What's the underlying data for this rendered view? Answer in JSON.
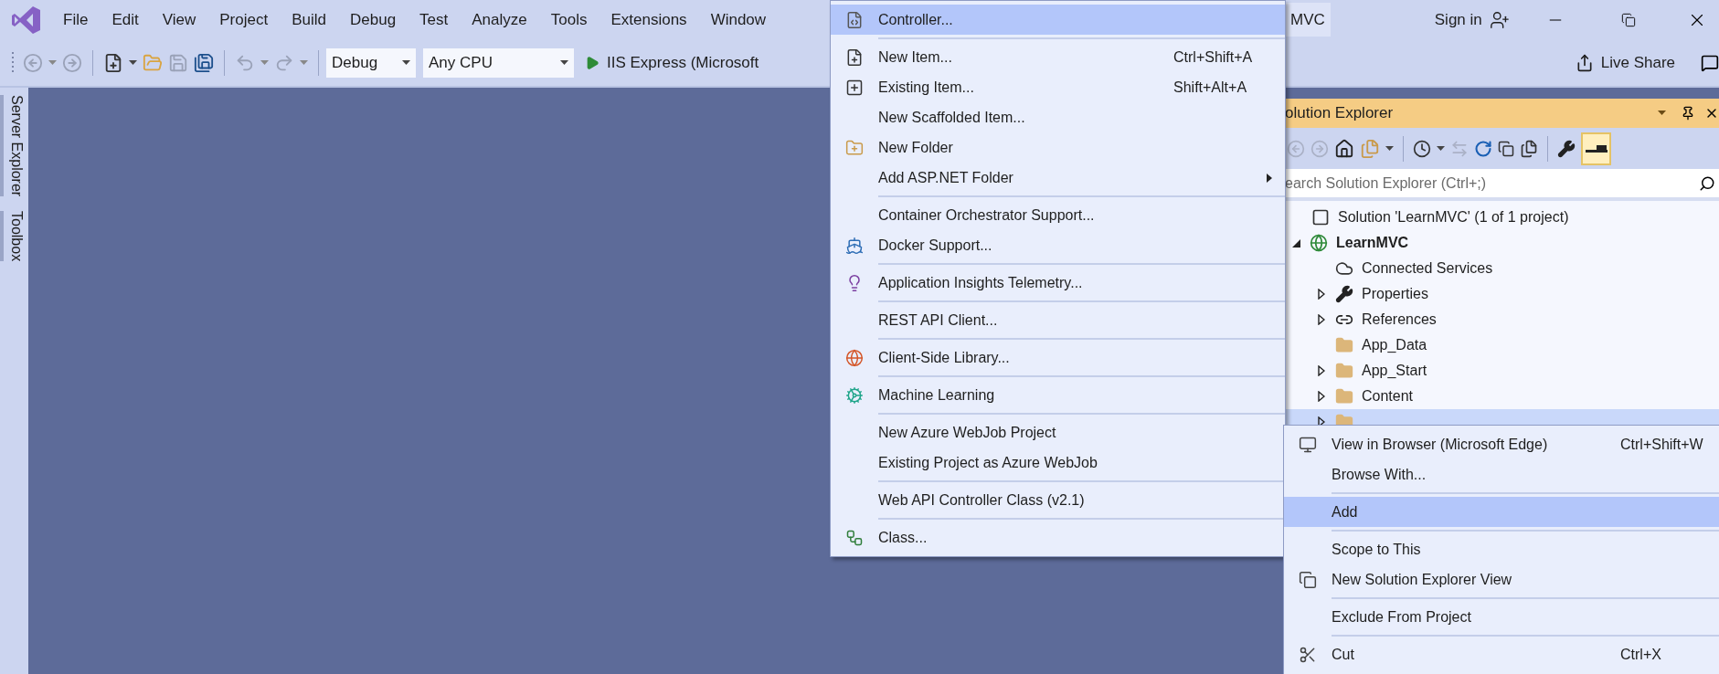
{
  "menu_bar": {
    "items": [
      "File",
      "Edit",
      "View",
      "Project",
      "Build",
      "Debug",
      "Test",
      "Analyze",
      "Tools",
      "Extensions",
      "Window"
    ],
    "title": "MVC",
    "sign_in": "Sign in"
  },
  "toolbar": {
    "configuration": "Debug",
    "platform": "Any CPU",
    "run_target": "IIS Express (Microsoft",
    "live_share": "Live Share"
  },
  "side_tabs": [
    "Server Explorer",
    "Toolbox"
  ],
  "solution_explorer": {
    "title": "olution Explorer",
    "search": {
      "placeholder": "earch Solution Explorer (Ctrl+;)"
    },
    "preview_toggle": {
      "on": true
    },
    "tree": [
      {
        "label": "Solution 'LearnMVC' (1 of 1 project)",
        "kind": "solution",
        "selected": false,
        "children": [
          {
            "label": "LearnMVC",
            "kind": "project",
            "selected": false,
            "expanded": true,
            "children": [
              {
                "label": "Connected Services",
                "kind": "services",
                "selected": false
              },
              {
                "label": "Properties",
                "kind": "properties",
                "selected": false,
                "expanded": false
              },
              {
                "label": "References",
                "kind": "references",
                "selected": false,
                "expanded": false
              },
              {
                "label": "App_Data",
                "kind": "folder",
                "selected": false
              },
              {
                "label": "App_Start",
                "kind": "folder",
                "selected": false,
                "expanded": false
              },
              {
                "label": "Content",
                "kind": "folder",
                "selected": false,
                "expanded": false
              },
              {
                "kind": "folder",
                "selected": true,
                "expanded": false
              }
            ]
          }
        ]
      }
    ]
  },
  "add_submenu": {
    "groups": [
      [
        {
          "label": "Controller...",
          "kind": "controller",
          "selected": true
        }
      ],
      [
        {
          "label": "New Item...",
          "shortcut": "Ctrl+Shift+A",
          "kind": "new_item",
          "selected": false
        },
        {
          "label": "Existing Item...",
          "shortcut": "Shift+Alt+A",
          "kind": "existing_item",
          "selected": false
        },
        {
          "label": "New Scaffolded Item...",
          "kind": "none",
          "selected": false
        },
        {
          "label": "New Folder",
          "kind": "new_folder",
          "selected": false
        },
        {
          "label": "Add ASP.NET Folder",
          "kind": "none",
          "selected": false,
          "submenu": true
        }
      ],
      [
        {
          "label": "Container Orchestrator Support...",
          "kind": "none",
          "selected": false
        },
        {
          "label": "Docker Support...",
          "kind": "docker",
          "selected": false
        }
      ],
      [
        {
          "label": "Application Insights Telemetry...",
          "kind": "insights",
          "selected": false
        }
      ],
      [
        {
          "label": "REST API Client...",
          "kind": "none",
          "selected": false
        }
      ],
      [
        {
          "label": "Client-Side Library...",
          "kind": "library",
          "selected": false
        }
      ],
      [
        {
          "label": "Machine Learning",
          "kind": "ml",
          "selected": false
        }
      ],
      [
        {
          "label": "New Azure WebJob Project",
          "kind": "none",
          "selected": false
        },
        {
          "label": "Existing Project as Azure WebJob",
          "kind": "none",
          "selected": false
        }
      ],
      [
        {
          "label": "Web API Controller Class (v2.1)",
          "kind": "none",
          "selected": false
        }
      ],
      [
        {
          "label": "Class...",
          "kind": "class",
          "selected": false
        }
      ]
    ]
  },
  "context_menu": {
    "groups": [
      [
        {
          "label": "View in Browser (Microsoft Edge)",
          "shortcut": "Ctrl+Shift+W",
          "kind": "browser",
          "selected": false
        },
        {
          "label": "Browse With...",
          "kind": "none",
          "selected": false
        }
      ],
      [
        {
          "label": "Add",
          "kind": "none",
          "selected": true
        }
      ],
      [
        {
          "label": "Scope to This",
          "kind": "none",
          "selected": false
        },
        {
          "label": "New Solution Explorer View",
          "kind": "new_view",
          "selected": false
        }
      ],
      [
        {
          "label": "Exclude From Project",
          "kind": "none",
          "selected": false
        }
      ],
      [
        {
          "label": "Cut",
          "shortcut": "Ctrl+X",
          "kind": "cut",
          "selected": false
        }
      ]
    ]
  }
}
